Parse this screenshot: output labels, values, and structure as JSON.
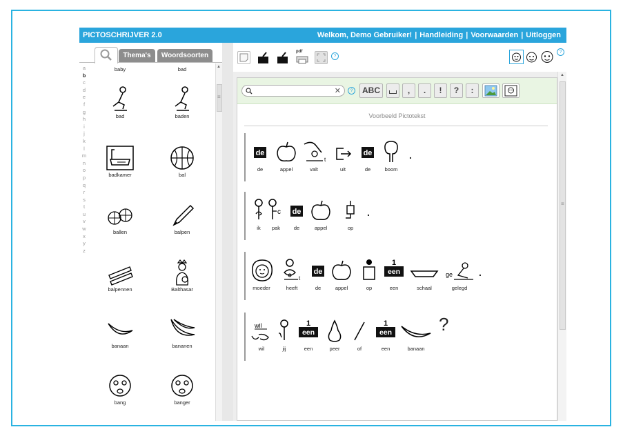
{
  "header": {
    "title": "PICTOSCHRIJVER 2.0",
    "welcome": "Welkom, Demo Gebruiker!",
    "sep": "|",
    "manual": "Handleiding",
    "terms": "Voorwaarden",
    "logout": "Uitloggen"
  },
  "left": {
    "tabs": {
      "themes": "Thema's",
      "wordtypes": "Woordsoorten"
    },
    "alphabet": [
      "a",
      "b",
      "c",
      "d",
      "e",
      "f",
      "g",
      "h",
      "i",
      "j",
      "k",
      "l",
      "m",
      "n",
      "o",
      "p",
      "q",
      "r",
      "s",
      "t",
      "u",
      "v",
      "w",
      "x",
      "y",
      "z"
    ],
    "active_letter": "b",
    "items": [
      "baby",
      "bad",
      "bad",
      "baden",
      "badkamer",
      "bal",
      "ballen",
      "balpen",
      "balpennen",
      "Balthasar",
      "banaan",
      "bananen",
      "bang",
      "banger"
    ]
  },
  "toolbar": {
    "pdf_label": "pdf",
    "help": "?"
  },
  "search": {
    "placeholder": "",
    "clear": "✕",
    "help": "?",
    "buttons": [
      "ABC",
      "␣",
      ",",
      ".",
      "!",
      "?",
      ":"
    ]
  },
  "doc": {
    "title": "Voorbeeld Pictotekst",
    "article": "de",
    "num_one": "1",
    "een_label": "een",
    "sentences": [
      {
        "words": [
          "de",
          "appel",
          "valt",
          "uit",
          "de",
          "boom"
        ],
        "punct": "."
      },
      {
        "words": [
          "ik",
          "pak",
          "de",
          "appel",
          "op"
        ],
        "punct": "."
      },
      {
        "words": [
          "moeder",
          "heeft",
          "de",
          "appel",
          "op",
          "een",
          "schaal",
          "gelegd"
        ],
        "punct": "."
      },
      {
        "words": [
          "wil",
          "jij",
          "een",
          "peer",
          "of",
          "een",
          "banaan"
        ],
        "punct": "?"
      }
    ],
    "glyph_text": {
      "t": "t",
      "c": "c",
      "ge": "ge",
      "wil": "wil"
    }
  },
  "scroll_marker": "≡",
  "colors": {
    "accent": "#2aa5dc",
    "frame": "#2ab3e1",
    "toolbar_green": "#e9f5e3"
  }
}
